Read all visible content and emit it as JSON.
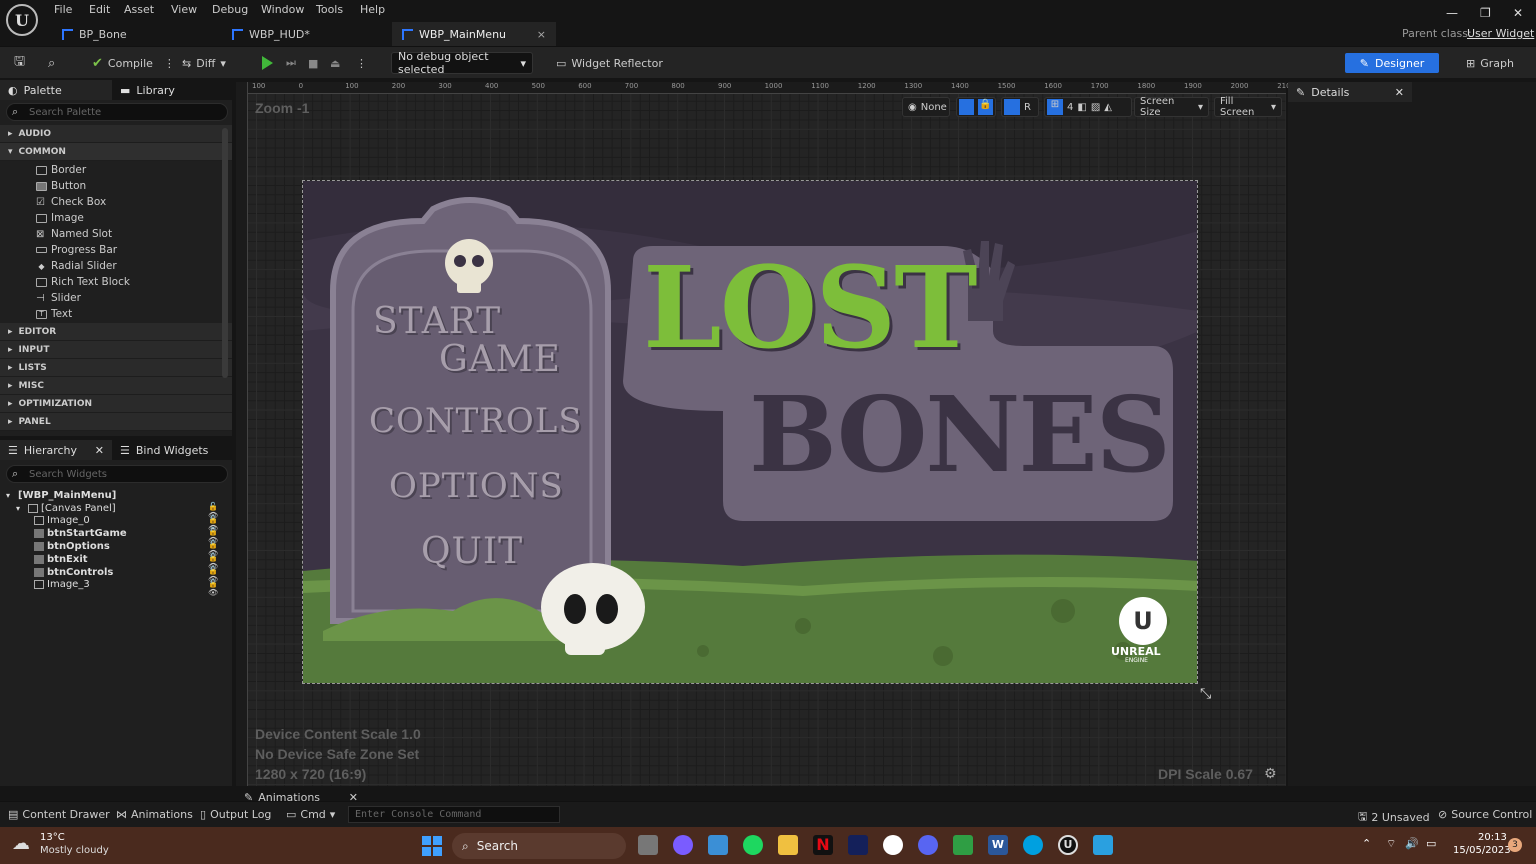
{
  "menubar": {
    "items": [
      "File",
      "Edit",
      "Asset",
      "View",
      "Debug",
      "Window",
      "Tools",
      "Help"
    ],
    "tabs": [
      {
        "label": "BP_Bone",
        "active": false
      },
      {
        "label": "WBP_HUD*",
        "active": false
      },
      {
        "label": "WBP_MainMenu",
        "active": true
      }
    ],
    "tab_close": "×",
    "parent_class_label": "Parent class:",
    "parent_class_value": "User Widget"
  },
  "toolbar": {
    "compile": "Compile",
    "diff": "Diff",
    "debug_object": "No debug object selected",
    "widget_reflector": "Widget Reflector",
    "designer": "Designer",
    "graph": "Graph"
  },
  "palette": {
    "tab_palette": "Palette",
    "tab_library": "Library",
    "search_placeholder": "Search Palette",
    "categories_before": [
      "AUDIO"
    ],
    "open_category": "COMMON",
    "items": [
      "Border",
      "Button",
      "Check Box",
      "Image",
      "Named Slot",
      "Progress Bar",
      "Radial Slider",
      "Rich Text Block",
      "Slider",
      "Text"
    ],
    "categories_after": [
      "EDITOR",
      "INPUT",
      "LISTS",
      "MISC",
      "OPTIMIZATION",
      "PANEL"
    ]
  },
  "hierarchy": {
    "tab_hierarchy": "Hierarchy",
    "tab_bind": "Bind Widgets",
    "search_placeholder": "Search Widgets",
    "root": "[WBP_MainMenu]",
    "canvas": "[Canvas Panel]",
    "children": [
      {
        "name": "Image_0",
        "bold": false
      },
      {
        "name": "btnStartGame",
        "bold": true
      },
      {
        "name": "btnOptions",
        "bold": true
      },
      {
        "name": "btnExit",
        "bold": true
      },
      {
        "name": "btnControls",
        "bold": true
      },
      {
        "name": "Image_3",
        "bold": false
      }
    ]
  },
  "viewport": {
    "zoom": "Zoom -1",
    "ruler_ticks": [
      "100",
      "0",
      "100",
      "200",
      "300",
      "400",
      "500",
      "600",
      "700",
      "800",
      "900",
      "1000",
      "1100",
      "1200",
      "1300",
      "1400",
      "1500",
      "1600",
      "1700",
      "1800",
      "1900",
      "2000",
      "210"
    ],
    "none": "None",
    "r": "R",
    "grid_num": "4",
    "screen_size": "Screen Size",
    "fill_screen": "Fill Screen",
    "content_scale": "Device Content Scale 1.0",
    "safe_zone": "No Device Safe Zone Set",
    "resolution": "1280 x 720 (16:9)",
    "dpi": "DPI Scale 0.67"
  },
  "art": {
    "menu": [
      "START",
      "GAME",
      "CONTROLS",
      "OPTIONS",
      "QUIT"
    ],
    "title_1": "LOST",
    "title_2": "BONES",
    "engine_logo": "UNREAL",
    "engine_sub": "ENGINE"
  },
  "details": {
    "title": "Details"
  },
  "bottombar": {
    "content_drawer": "Content Drawer",
    "animations": "Animations",
    "output_log": "Output Log",
    "cmd": "Cmd",
    "console_placeholder": "Enter Console Command",
    "anim_tab": "Animations",
    "unsaved": "2 Unsaved",
    "source_control": "Source Control"
  },
  "taskbar": {
    "temp": "13°C",
    "weather": "Mostly cloudy",
    "search": "Search",
    "time": "20:13",
    "date": "15/05/2023",
    "badge": "3"
  },
  "colors": {
    "accent": "#2670e0",
    "title_green": "#7dbe3a",
    "stone": "#6e6478",
    "grass": "#557a3c",
    "sky": "#3b3344"
  }
}
